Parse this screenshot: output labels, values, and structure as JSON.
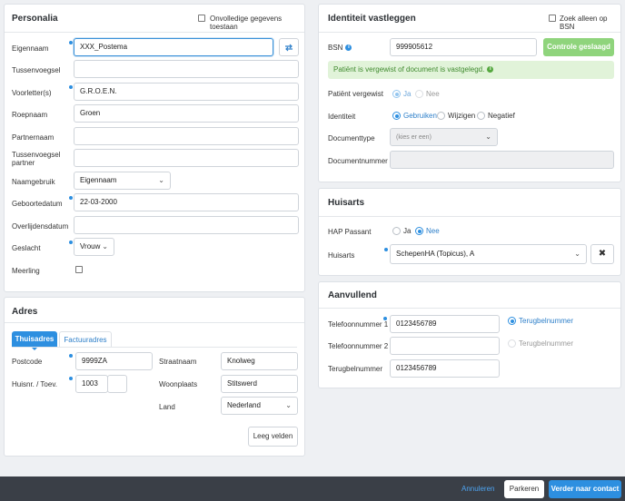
{
  "personalia": {
    "title": "Personalia",
    "incomplete_label": "Onvolledige gegevens toestaan",
    "fields": {
      "eigennaam": {
        "label": "Eigennaam",
        "value": "XXX_Postema"
      },
      "tussenvoegsel": {
        "label": "Tussenvoegsel",
        "value": ""
      },
      "voorletters": {
        "label": "Voorletter(s)",
        "value": "G.R.O.E.N."
      },
      "roepnaam": {
        "label": "Roepnaam",
        "value": "Groen"
      },
      "partnernaam": {
        "label": "Partnernaam",
        "value": ""
      },
      "tussenvoegsel_partner": {
        "label": "Tussenvoegsel partner",
        "value": ""
      },
      "naamgebruik": {
        "label": "Naamgebruik",
        "value": "Eigennaam"
      },
      "geboortedatum": {
        "label": "Geboortedatum",
        "value": "22-03-2000"
      },
      "overlijdensdatum": {
        "label": "Overlijdensdatum",
        "value": ""
      },
      "geslacht": {
        "label": "Geslacht",
        "value": "Vrouw"
      },
      "meerling": {
        "label": "Meerling"
      }
    }
  },
  "adres": {
    "title": "Adres",
    "tabs": [
      "Thuisadres",
      "Factuuradres"
    ],
    "postcode": {
      "label": "Postcode",
      "value": "9999ZA"
    },
    "huisnr": {
      "label": "Huisnr. / Toev.",
      "value": "1003",
      "toev": ""
    },
    "straatnaam": {
      "label": "Straatnaam",
      "value": "Knolweg"
    },
    "woonplaats": {
      "label": "Woonplaats",
      "value": "Stitswerd"
    },
    "land": {
      "label": "Land",
      "value": "Nederland"
    },
    "clear_button": "Leeg velden"
  },
  "identiteit": {
    "title": "Identiteit vastleggen",
    "zoek_bsn_label": "Zoek alleen op BSN",
    "bsn": {
      "label": "BSN",
      "value": "999905612"
    },
    "controle_button": "Controle geslaagd",
    "success_message": "Patiënt is vergewist of document is vastgelegd.",
    "vergewist": {
      "label": "Patiënt vergewist",
      "options": [
        "Ja",
        "Nee"
      ]
    },
    "identiteit": {
      "label": "Identiteit",
      "options": [
        "Gebruiken",
        "Wijzigen",
        "Negatief"
      ]
    },
    "documenttype": {
      "label": "Documenttype",
      "placeholder": "(kies er een)"
    },
    "documentnummer": {
      "label": "Documentnummer",
      "value": ""
    }
  },
  "huisarts": {
    "title": "Huisarts",
    "hap": {
      "label": "HAP Passant",
      "options": [
        "Ja",
        "Nee"
      ]
    },
    "huisarts": {
      "label": "Huisarts",
      "value": "SchepenHA (Topicus), A"
    }
  },
  "aanvullend": {
    "title": "Aanvullend",
    "tel1": {
      "label": "Telefoonnummer 1",
      "value": "0123456789"
    },
    "tel2": {
      "label": "Telefoonnummer 2",
      "value": ""
    },
    "terugbel": {
      "label": "Terugbelnummer",
      "value": "0123456789"
    },
    "terugbel_radio": "Terugbelnummer"
  },
  "footer": {
    "cancel": "Annuleren",
    "park": "Parkeren",
    "continue": "Verder naar contact"
  },
  "colors": {
    "accent": "#2d8fe0",
    "success_bg": "#e1f3d9",
    "success_btn": "#8fd47c",
    "footer_bg": "#3a3f47"
  }
}
